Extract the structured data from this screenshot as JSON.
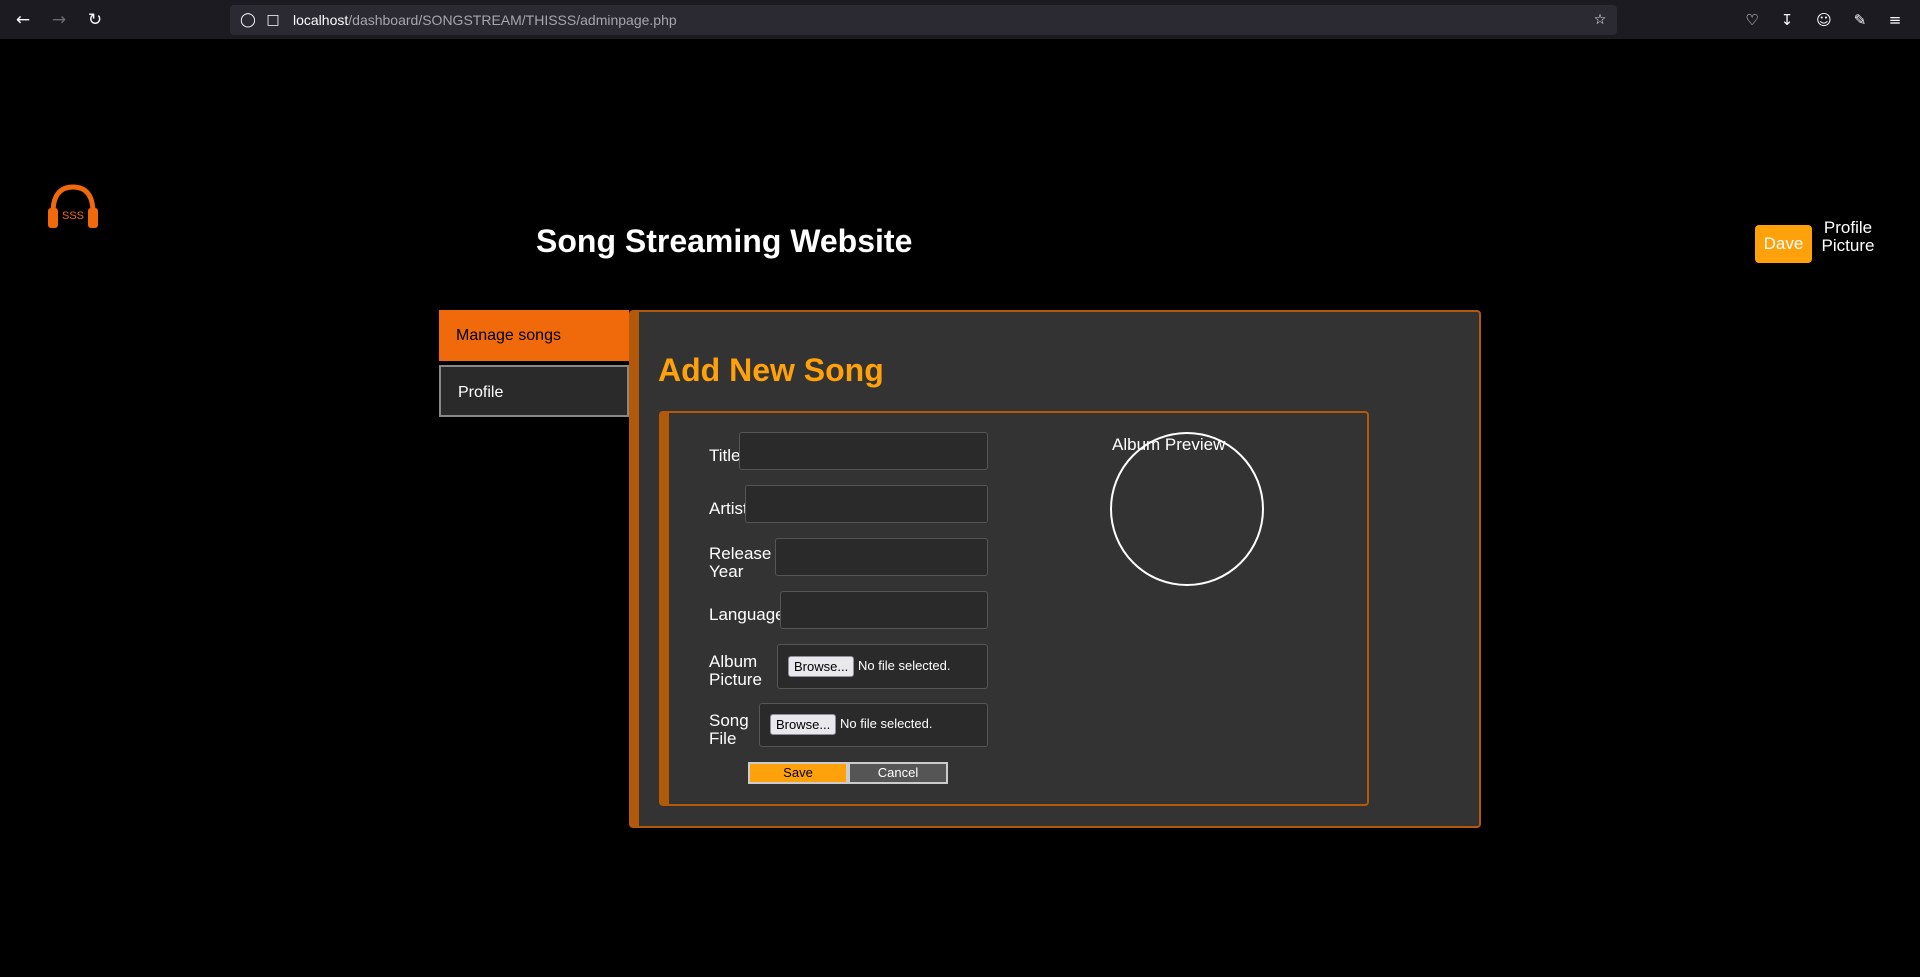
{
  "browser": {
    "url_host": "localhost",
    "url_path": "/dashboard/SONGSTREAM/THISSS/adminpage.php"
  },
  "header": {
    "logo_text": "SSS",
    "title": "Song Streaming Website",
    "user_button": "Dave",
    "profile_picture_alt": "Profile Picture"
  },
  "sidebar": {
    "items": [
      {
        "label": "Manage songs"
      },
      {
        "label": "Profile"
      }
    ]
  },
  "main": {
    "title": "Add New Song",
    "form": {
      "title_label": "Title",
      "artist_label": "Artist",
      "release_year_label": "Release Year",
      "language_label": "Language",
      "album_picture_label": "Album Picture",
      "song_file_label": "Song File",
      "browse_label": "Browse...",
      "no_file_label": "No file selected.",
      "title_value": "",
      "artist_value": "",
      "release_year_value": "",
      "language_value": "",
      "save_label": "Save",
      "cancel_label": "Cancel"
    },
    "preview_label": "Album Preview"
  },
  "colors": {
    "accent": "#ffa10a",
    "sidebar_active": "#f06a0c",
    "border": "#b35a0a",
    "panel_bg": "#333333"
  }
}
